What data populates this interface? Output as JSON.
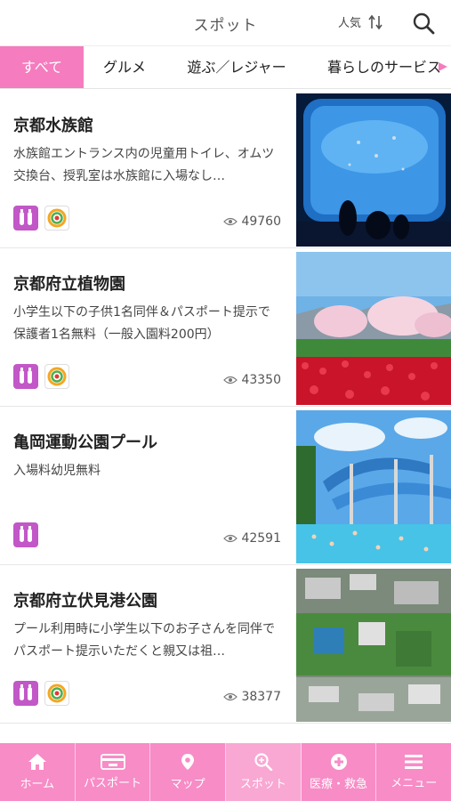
{
  "header": {
    "title": "スポット",
    "sort_label": "人気"
  },
  "tabs": [
    {
      "label": "すべて",
      "active": true
    },
    {
      "label": "グルメ",
      "active": false
    },
    {
      "label": "遊ぶ／レジャー",
      "active": false
    },
    {
      "label": "暮らしのサービス",
      "active": false
    }
  ],
  "spots": [
    {
      "title": "京都水族館",
      "desc": "水族館エントランス内の児童用トイレ、オムツ交換台、授乳室は水族館に入場なし…",
      "views": "49760",
      "badges": [
        "baby",
        "rainbow"
      ]
    },
    {
      "title": "京都府立植物園",
      "desc": "小学生以下の子供1名同伴＆パスポート提示で保護者1名無料（一般入園料200円）",
      "views": "43350",
      "badges": [
        "baby",
        "rainbow"
      ]
    },
    {
      "title": "亀岡運動公園プール",
      "desc": "入場料幼児無料",
      "views": "42591",
      "badges": [
        "baby"
      ]
    },
    {
      "title": "京都府立伏見港公園",
      "desc": "プール利用時に小学生以下のお子さんを同伴でパスポート提示いただくと親又は祖…",
      "views": "38377",
      "badges": [
        "baby",
        "rainbow"
      ]
    }
  ],
  "nav": [
    {
      "label": "ホーム",
      "icon": "home-icon"
    },
    {
      "label": "パスポート",
      "icon": "passport-icon"
    },
    {
      "label": "マップ",
      "icon": "map-pin-icon"
    },
    {
      "label": "スポット",
      "icon": "spot-search-icon",
      "active": true
    },
    {
      "label": "医療・救急",
      "icon": "medical-cross-icon"
    },
    {
      "label": "メニュー",
      "icon": "menu-icon"
    }
  ],
  "colors": {
    "accent": "#f57cbe",
    "nav_bg": "#f78cc6",
    "nav_active": "#f9a7d3",
    "badge_purple": "#c257c7"
  }
}
